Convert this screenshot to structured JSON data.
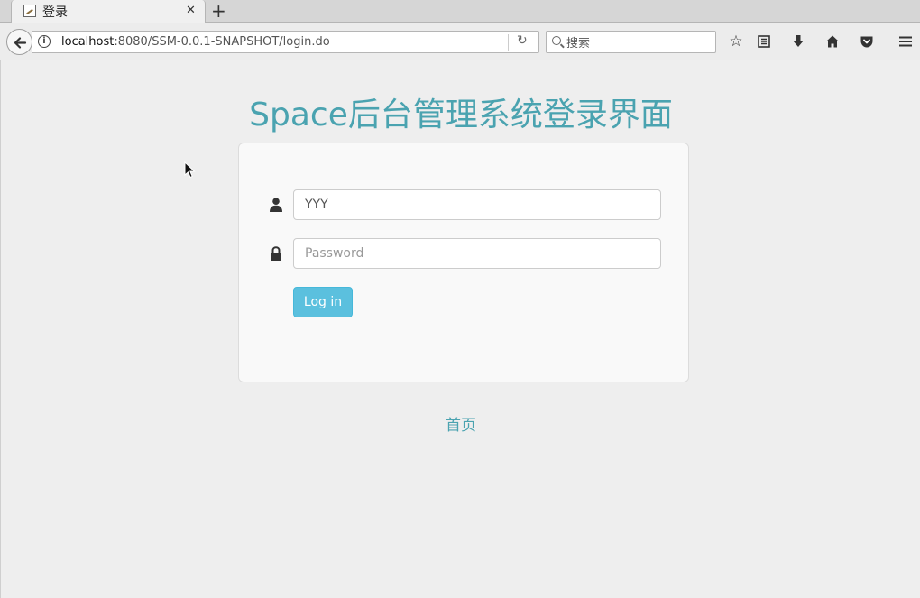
{
  "browser": {
    "tab": {
      "title": "登录"
    },
    "url": {
      "host": "localhost",
      "rest": ":8080/SSM-0.0.1-SNAPSHOT/login.do"
    },
    "search": {
      "placeholder": "搜索"
    }
  },
  "page": {
    "title": "Space后台管理系统登录界面",
    "username": {
      "value": "YYY"
    },
    "password": {
      "placeholder": "Password"
    },
    "login_button": "Log in",
    "home_link": "首页"
  },
  "colors": {
    "accent_text": "#4aa3b0",
    "button": "#5bc0de"
  },
  "icons": [
    "info-icon",
    "reload-icon",
    "search-icon",
    "bookmark-star-icon",
    "reading-list-icon",
    "download-icon",
    "home-icon",
    "pocket-icon",
    "menu-icon",
    "user-icon",
    "lock-icon"
  ]
}
